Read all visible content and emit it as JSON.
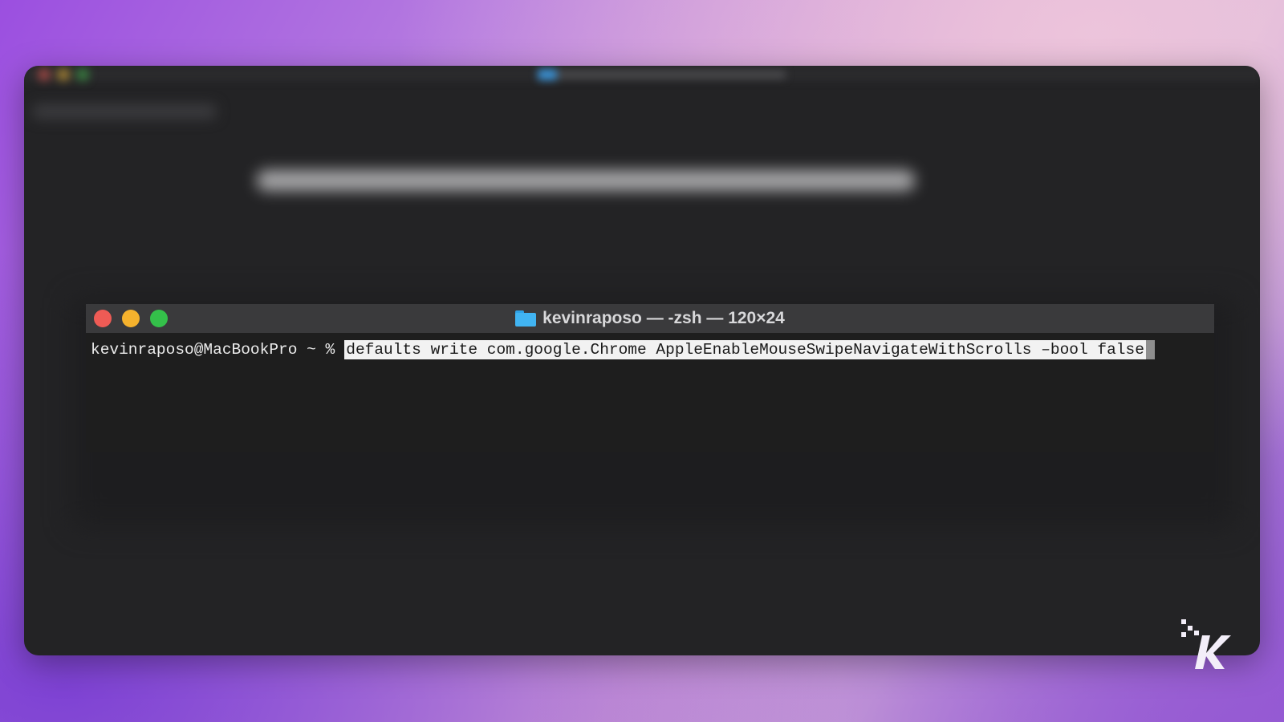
{
  "terminal": {
    "title": "kevinraposo — -zsh — 120×24",
    "prompt": "kevinraposo@MacBookPro ~ %",
    "command": "defaults write com.google.Chrome AppleEnableMouseSwipeNavigateWithScrolls –bool false"
  },
  "icons": {
    "folder": "folder-icon",
    "close": "close-window-icon",
    "minimize": "minimize-window-icon",
    "maximize": "maximize-window-icon",
    "logo": "knowtechie-k-logo"
  },
  "colors": {
    "close": "#ee5b55",
    "minimize": "#f5b22d",
    "maximize": "#34c04a",
    "folder": "#41b4f2",
    "terminal_bg": "#1e1e1e",
    "titlebar_bg": "#3a3a3c"
  }
}
